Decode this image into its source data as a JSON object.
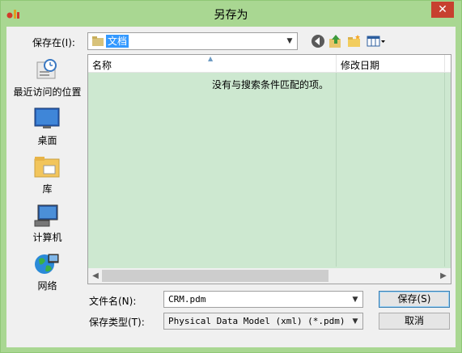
{
  "window": {
    "title": "另存为",
    "close_glyph": "✕"
  },
  "toolbar": {
    "save_in_label": "保存在(I):",
    "save_in_value": "文档",
    "back_icon": "back-arrow-icon",
    "up_icon": "up-folder-icon",
    "new_folder_icon": "new-folder-icon",
    "view_icon": "view-menu-icon"
  },
  "places": [
    {
      "label": "最近访问的位置",
      "icon": "recent-places-icon"
    },
    {
      "label": "桌面",
      "icon": "desktop-icon"
    },
    {
      "label": "库",
      "icon": "libraries-icon"
    },
    {
      "label": "计算机",
      "icon": "computer-icon"
    },
    {
      "label": "网络",
      "icon": "network-icon"
    }
  ],
  "filelist": {
    "columns": [
      "名称",
      "修改日期",
      "‌"
    ],
    "empty_message": "没有与搜索条件匹配的项。"
  },
  "form": {
    "filename_label": "文件名(N):",
    "filename_value": "CRM.pdm",
    "filetype_label": "保存类型(T):",
    "filetype_value": "Physical Data Model (xml) (*.pdm)",
    "save_label": "保存(S)",
    "cancel_label": "取消"
  },
  "colors": {
    "window_frame": "#a9d792",
    "list_background": "#cde8d0",
    "selection": "#3399ff",
    "close_button": "#c7402f"
  }
}
